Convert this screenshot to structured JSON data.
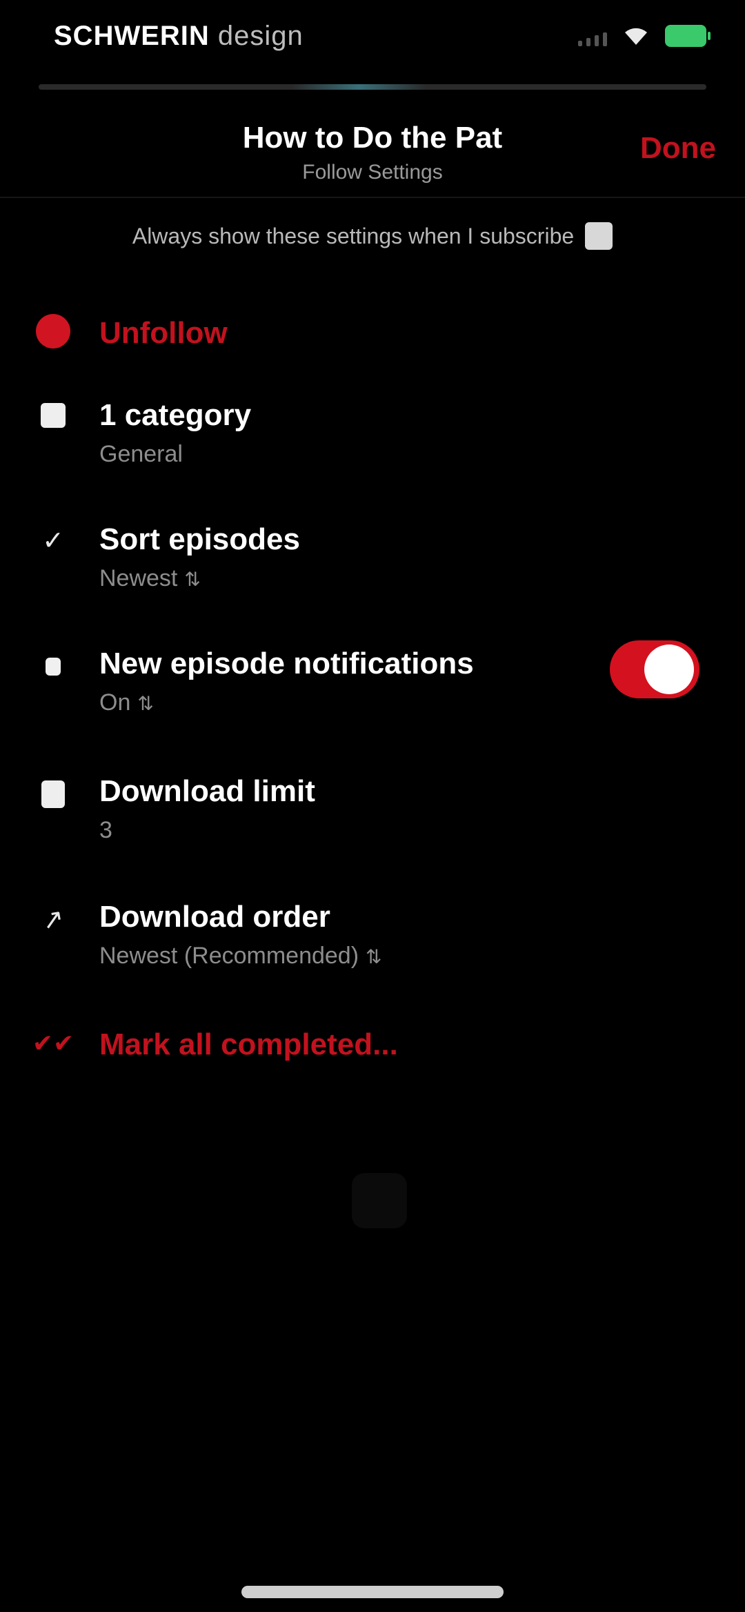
{
  "status_bar": {
    "carrier_strong": "SCHWERIN",
    "carrier_light": " design"
  },
  "header": {
    "title": "How to Do the Pat",
    "subtitle": "Follow Settings",
    "done_label": "Done"
  },
  "always_show": {
    "label": "Always show these settings when I subscribe"
  },
  "rows": [
    {
      "label": "Unfollow"
    },
    {
      "label": "1 category",
      "sub": "General"
    },
    {
      "label": "Sort episodes",
      "sub": "Newest"
    },
    {
      "label": "New episode notifications",
      "sub": "On",
      "toggle_on": true
    },
    {
      "label": "Download limit",
      "sub": "3"
    },
    {
      "label": "Download order",
      "sub": "Newest (Recommended)"
    },
    {
      "label": "Mark all completed..."
    }
  ],
  "colors": {
    "accent_red": "#c2121e",
    "toggle_red": "#d4111f",
    "battery_green": "#3ac96b"
  },
  "icons": [
    "signal-icon",
    "wifi-icon",
    "battery-icon",
    "checkbox-icon",
    "unfollow-icon",
    "category-icon",
    "sort-icon",
    "bell-icon",
    "download-limit-icon",
    "download-order-icon",
    "mark-completed-icon"
  ]
}
